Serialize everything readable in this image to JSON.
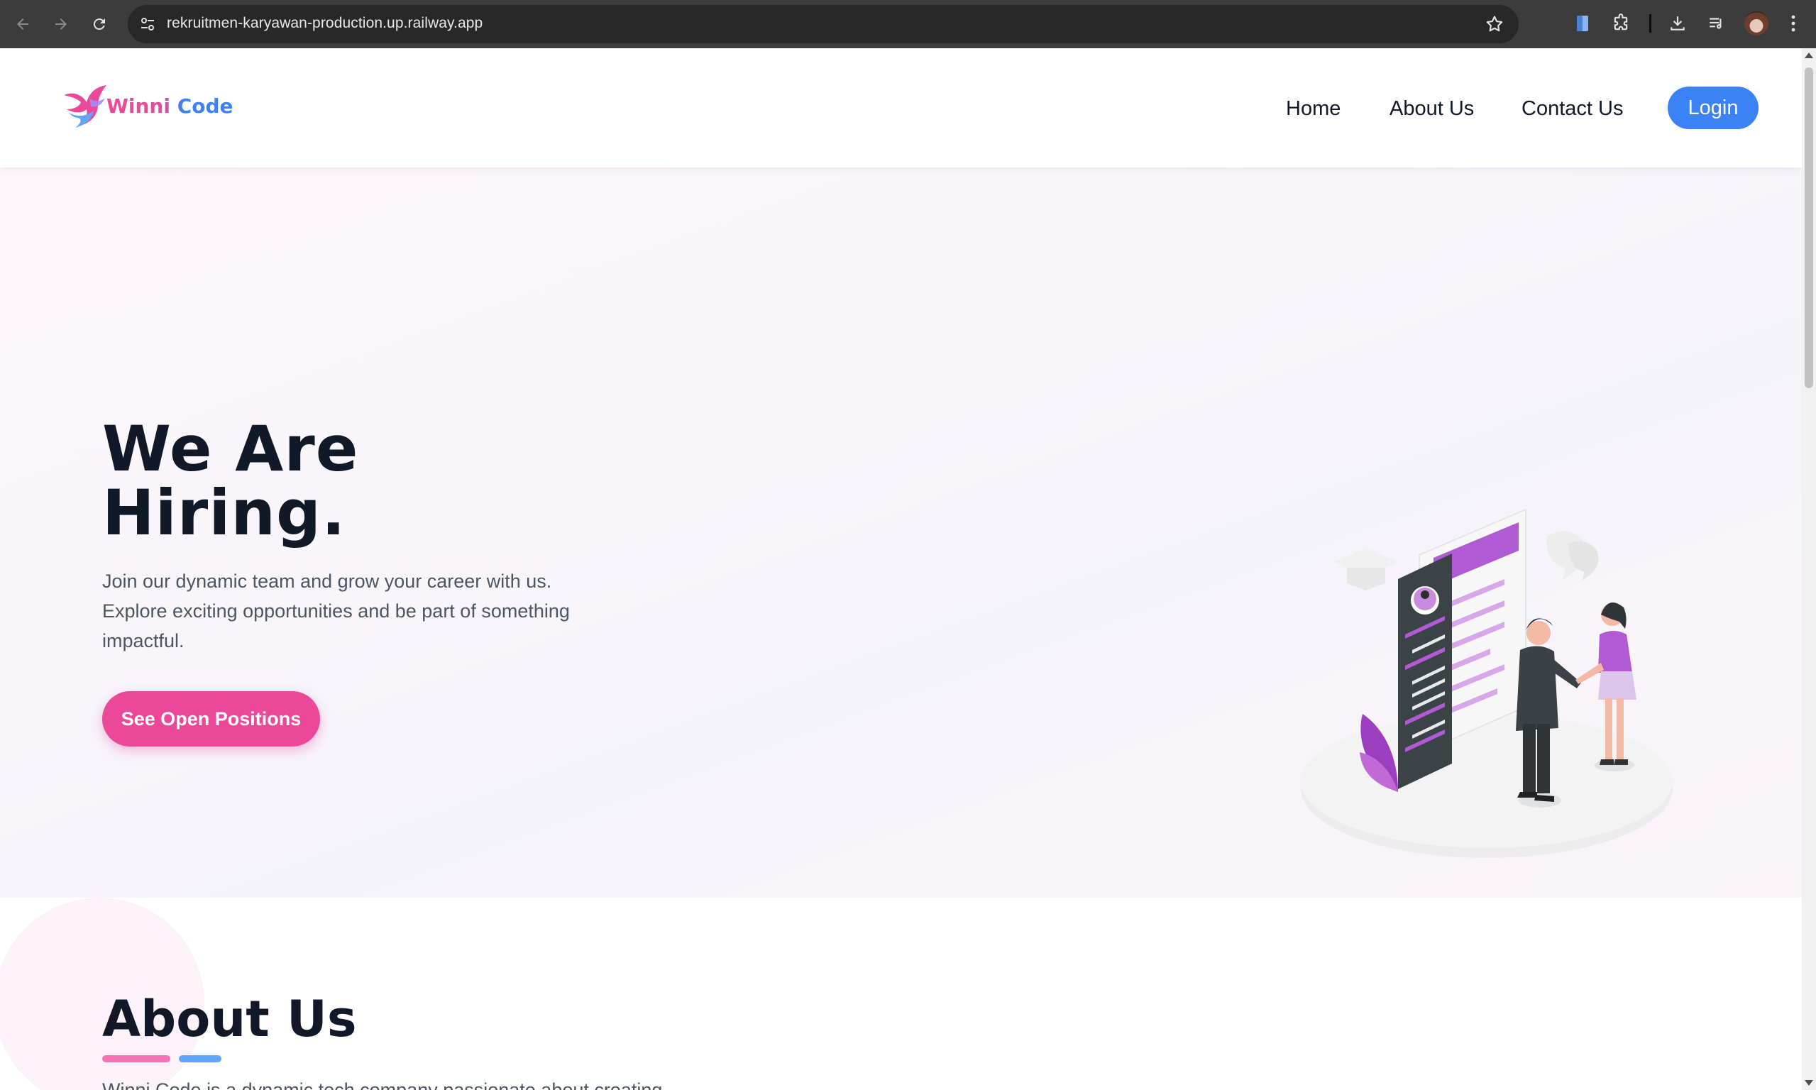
{
  "browser": {
    "url": "rekruitmen-karyawan-production.up.railway.app"
  },
  "header": {
    "logo_text": "Winni Code",
    "nav": [
      "Home",
      "About Us",
      "Contact Us"
    ],
    "login_label": "Login"
  },
  "hero": {
    "title_line1": "We Are",
    "title_line2": "Hiring.",
    "description": "Join our dynamic team and grow your career with us. Explore exciting opportunities and be part of something impactful.",
    "cta_label": "See Open Positions"
  },
  "about": {
    "title": "About Us",
    "description": "Winni Code is a dynamic tech company passionate about creating"
  },
  "colors": {
    "brand_pink": "#ec4899",
    "brand_blue": "#3b82f6",
    "heading": "#111827",
    "text": "#4b5563",
    "illustration_purple": "#b05ad3"
  }
}
